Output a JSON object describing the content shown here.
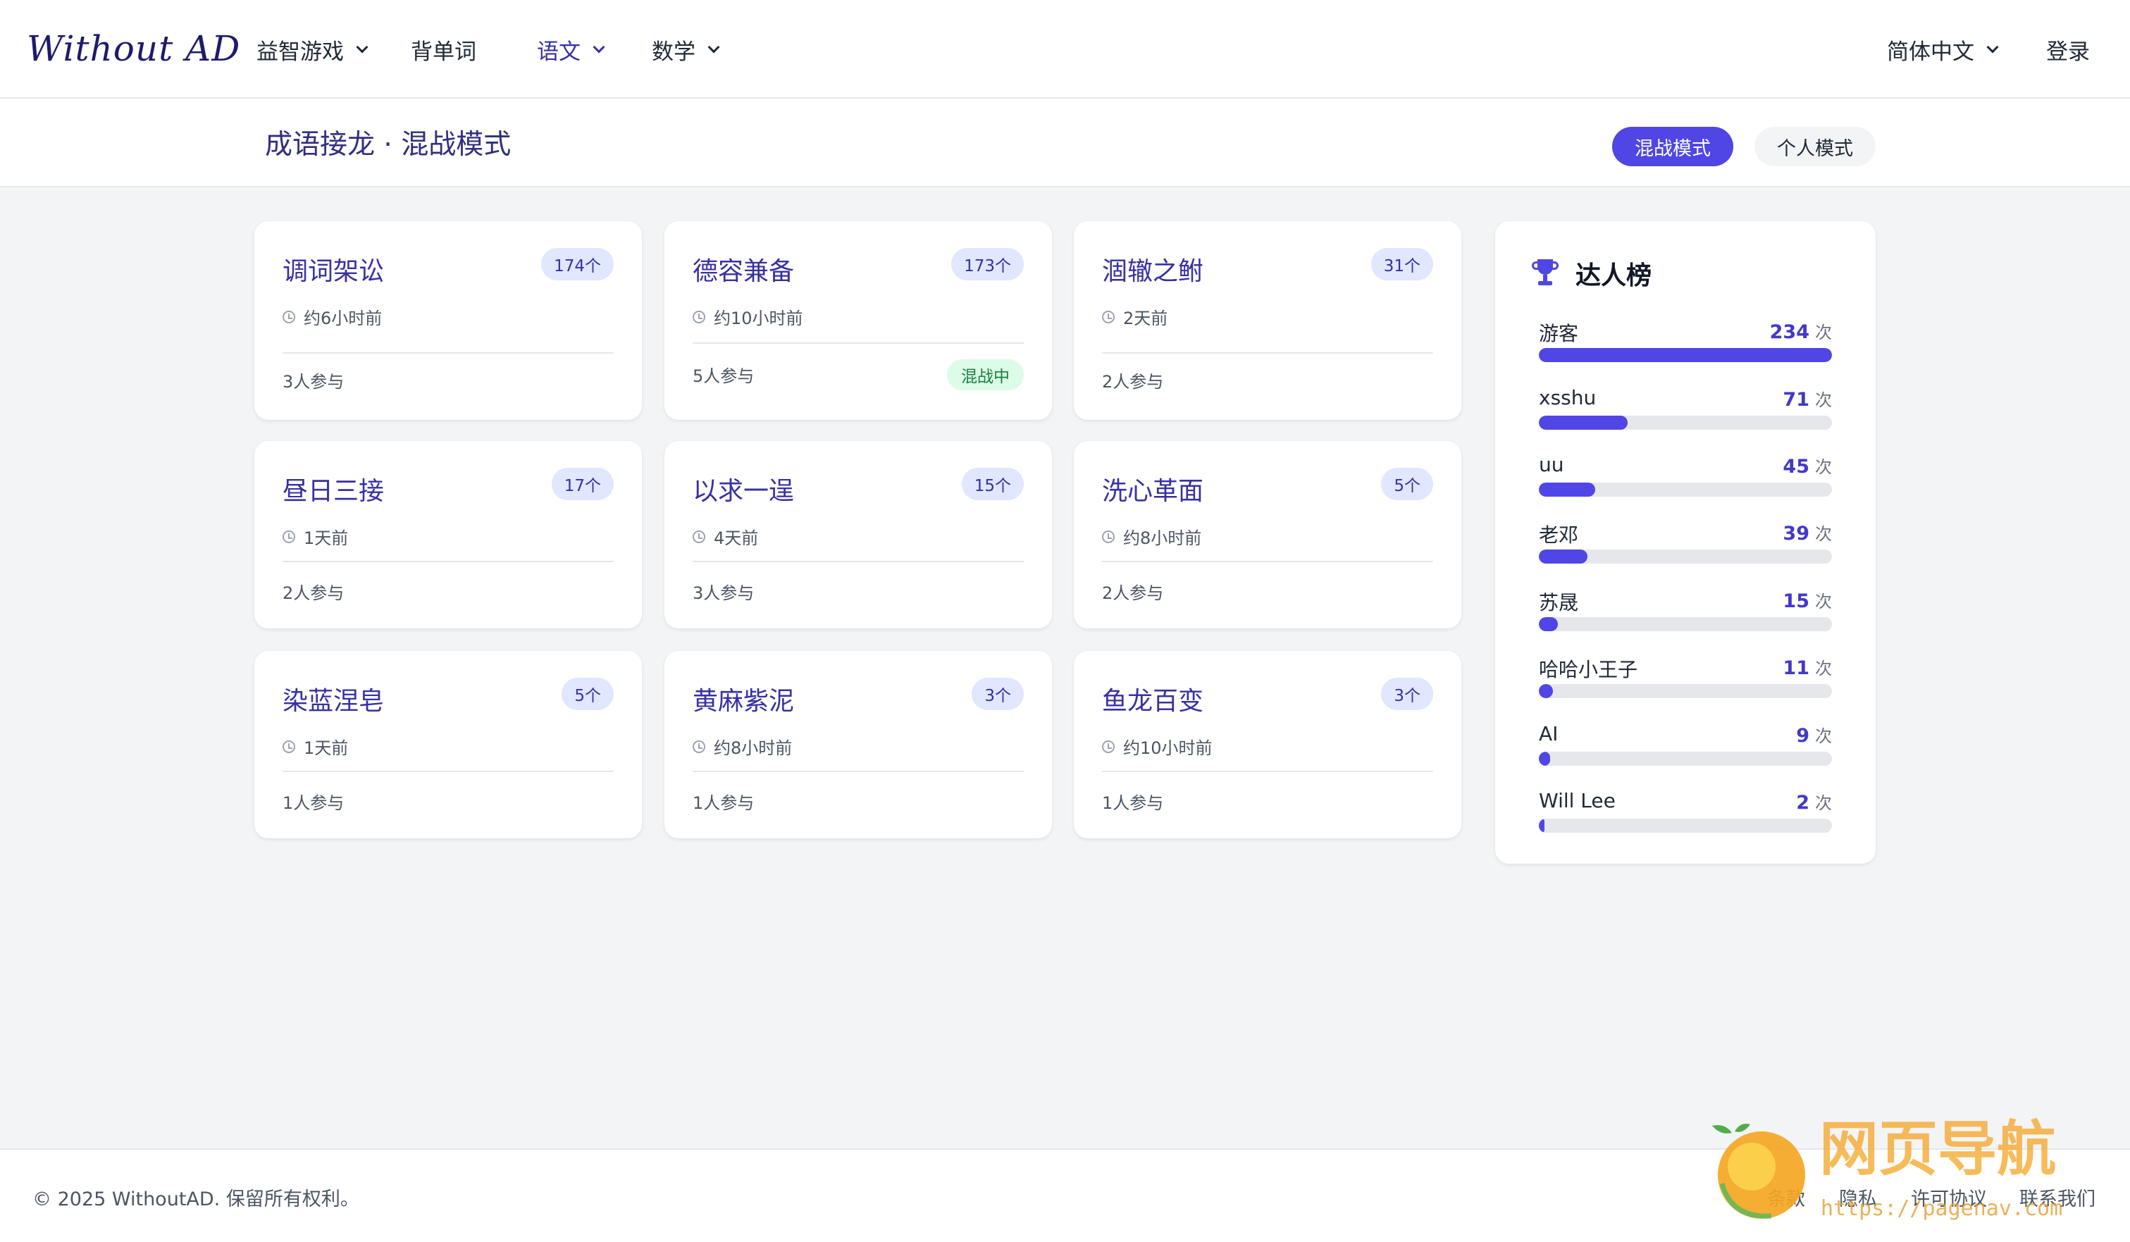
{
  "nav": {
    "logo": "Without AD",
    "items": [
      {
        "label": "益智游戏",
        "dropdown": true,
        "active": false
      },
      {
        "label": "背单词",
        "dropdown": false,
        "active": false
      },
      {
        "label": "语文",
        "dropdown": true,
        "active": true
      },
      {
        "label": "数学",
        "dropdown": true,
        "active": false
      }
    ],
    "language": "简体中文",
    "login": "登录"
  },
  "subheader": {
    "title": "成语接龙 · 混战模式",
    "mode_active": "混战模式",
    "mode_inactive": "个人模式"
  },
  "cards": [
    {
      "title": "调词架讼",
      "count": "174个",
      "time": "约6小时前",
      "participants": "3人参与",
      "status": ""
    },
    {
      "title": "德容兼备",
      "count": "173个",
      "time": "约10小时前",
      "participants": "5人参与",
      "status": "混战中"
    },
    {
      "title": "涸辙之鲋",
      "count": "31个",
      "time": "2天前",
      "participants": "2人参与",
      "status": ""
    },
    {
      "title": "昼日三接",
      "count": "17个",
      "time": "1天前",
      "participants": "2人参与",
      "status": ""
    },
    {
      "title": "以求一逞",
      "count": "15个",
      "time": "4天前",
      "participants": "3人参与",
      "status": ""
    },
    {
      "title": "洗心革面",
      "count": "5个",
      "time": "约8小时前",
      "participants": "2人参与",
      "status": ""
    },
    {
      "title": "染蓝涅皂",
      "count": "5个",
      "time": "1天前",
      "participants": "1人参与",
      "status": ""
    },
    {
      "title": "黄麻紫泥",
      "count": "3个",
      "time": "约8小时前",
      "participants": "1人参与",
      "status": ""
    },
    {
      "title": "鱼龙百变",
      "count": "3个",
      "time": "约10小时前",
      "participants": "1人参与",
      "status": ""
    }
  ],
  "leaderboard": {
    "title": "达人榜",
    "unit": "次",
    "entries": [
      {
        "name": "游客",
        "score": "234",
        "fraction": 1.0
      },
      {
        "name": "xsshu",
        "score": "71",
        "fraction": 0.303
      },
      {
        "name": "uu",
        "score": "45",
        "fraction": 0.192
      },
      {
        "name": "老邓",
        "score": "39",
        "fraction": 0.167
      },
      {
        "name": "苏晟",
        "score": "15",
        "fraction": 0.064
      },
      {
        "name": "哈哈小王子",
        "score": "11",
        "fraction": 0.047
      },
      {
        "name": "AI",
        "score": "9",
        "fraction": 0.038
      },
      {
        "name": "Will Lee",
        "score": "2",
        "fraction": 0.009
      }
    ]
  },
  "footer": {
    "copyright": "© 2025 WithoutAD. 保留所有权利。",
    "links": [
      "条款",
      "隐私",
      "许可协议",
      "联系我们"
    ]
  },
  "watermark": {
    "brand": "网页导航",
    "url": "https://pagenav.com"
  },
  "colors": {
    "accent": "#4f46e5",
    "title_text": "#3730a3",
    "status_green": "#15803d",
    "status_green_bg": "#dcfce7",
    "count_badge_bg": "#e0e7ff"
  }
}
